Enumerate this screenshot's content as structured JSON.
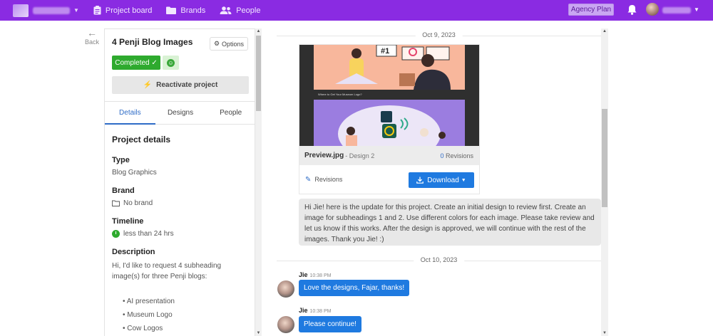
{
  "nav": {
    "items": [
      {
        "label": "Project board",
        "icon": "clipboard-icon"
      },
      {
        "label": "Brands",
        "icon": "folder-icon"
      },
      {
        "label": "People",
        "icon": "people-icon"
      }
    ],
    "agency_plan": "Agency Plan",
    "accent": "#8a2be2"
  },
  "back_label": "Back",
  "project": {
    "title": "4 Penji Blog Images",
    "options_label": "Options",
    "status": "Completed ✓",
    "reactivate_label": "Reactivate project",
    "tabs": [
      "Details",
      "Designs",
      "People"
    ],
    "details": {
      "section_title": "Project details",
      "type_label": "Type",
      "type_value": "Blog Graphics",
      "brand_label": "Brand",
      "brand_value": "No brand",
      "timeline_label": "Timeline",
      "timeline_value": "less than 24 hrs",
      "description_label": "Description",
      "description_text": "Hi, I'd like to request 4 subheading image(s) for three Penji blogs:",
      "bullets": [
        "• AI presentation",
        "• Museum Logo",
        "• Cow Logos"
      ]
    }
  },
  "chat": {
    "date1": "Oct 9, 2023",
    "preview": {
      "caption": "Where to Get Your Museum Logo?",
      "file_name": "Preview.jpg",
      "design": "- Design 2",
      "revisions_count": "0",
      "revisions_word": "Revisions",
      "revisions_link": "Revisions",
      "download_label": "Download"
    },
    "gray_message": "Hi Jie! here is the update for this project. Create an initial design to review first. Create an image for subheadings 1 and 2. Use different colors for each image. Please take review and let us know if this works. After the design is approved, we will continue with the rest of the images. Thank you Jie! :)",
    "date2": "Oct 10, 2023",
    "messages": [
      {
        "sender": "Jie",
        "time": "10:38 PM",
        "text": "Love the designs, Fajar, thanks!"
      },
      {
        "sender": "Jie",
        "time": "10:38 PM",
        "text": "Please continue!"
      }
    ]
  }
}
